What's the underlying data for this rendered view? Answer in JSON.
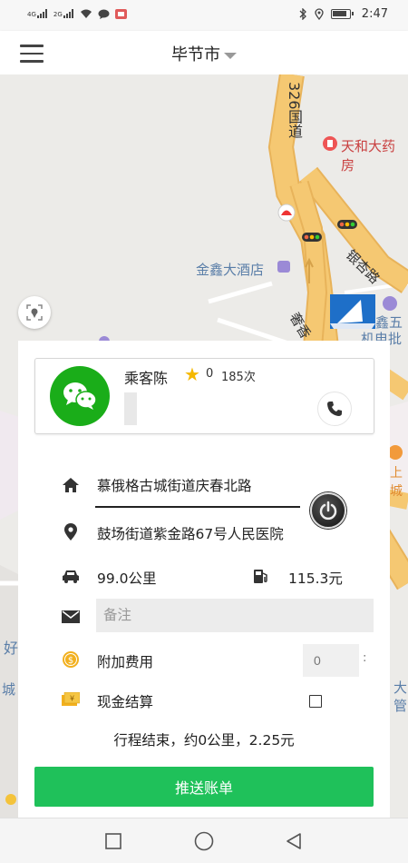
{
  "status_bar": {
    "signal1": "4G",
    "signal2": "2G",
    "time": "2:47"
  },
  "header": {
    "city": "毕节市"
  },
  "map": {
    "labels": {
      "road_326": "326国道",
      "pharmacy": "天和大药房",
      "hotel": "金鑫大酒店",
      "yinxing_road": "银杏路",
      "road_partial": "奢香",
      "jinxin_partial": "鑫五",
      "market_partial": "机电批",
      "left_hao": "好",
      "left_cheng": "城",
      "right_da": "大",
      "right_guan": "管",
      "right_shang": "上城"
    },
    "road_color": "#f5c872"
  },
  "passenger": {
    "name": "乘客陈",
    "rating": "0",
    "trips": "185次"
  },
  "trip": {
    "origin": "慕俄格古城街道庆春北路",
    "destination": "鼓场街道紫金路67号人民医院",
    "distance": "99.0公里",
    "fare": "115.3元",
    "note_placeholder": "备注",
    "extra_fee_label": "附加费用",
    "extra_fee_value": "0",
    "extra_fee_suffix": ":",
    "cash_label": "现金结算",
    "summary": "行程结束，约0公里，2.25元",
    "push_button": "推送账单"
  },
  "colors": {
    "wechat_green": "#1aad19",
    "button_green": "#1fc15a",
    "star": "#f5b800"
  }
}
